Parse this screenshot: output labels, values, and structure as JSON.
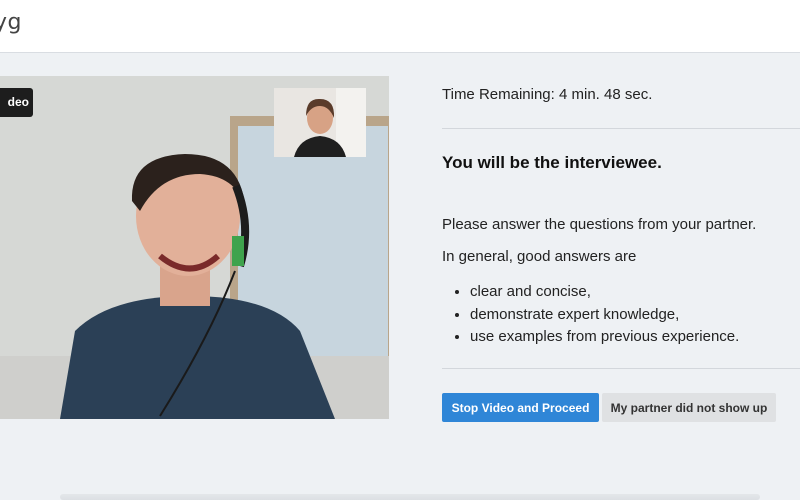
{
  "header": {
    "brand_text": "yg"
  },
  "video": {
    "badge_label": "deo",
    "self_view_icon": "webcam-feed",
    "partner_view_icon": "webcam-feed"
  },
  "panel": {
    "timer_text": "Time Remaining: 4 min. 48 sec.",
    "role_heading": "You will be the interviewee.",
    "instruction": "Please answer the questions from your partner.",
    "lead": "In general, good answers are",
    "criteria": [
      "clear and concise,",
      "demonstrate expert knowledge,",
      "use examples from previous experience."
    ]
  },
  "actions": {
    "proceed_label": "Stop Video and Proceed",
    "no_show_label": "My partner did not show up"
  },
  "colors": {
    "primary_button": "#2f86d7",
    "secondary_button": "#dfe1e3",
    "page_background": "#eef1f4"
  }
}
